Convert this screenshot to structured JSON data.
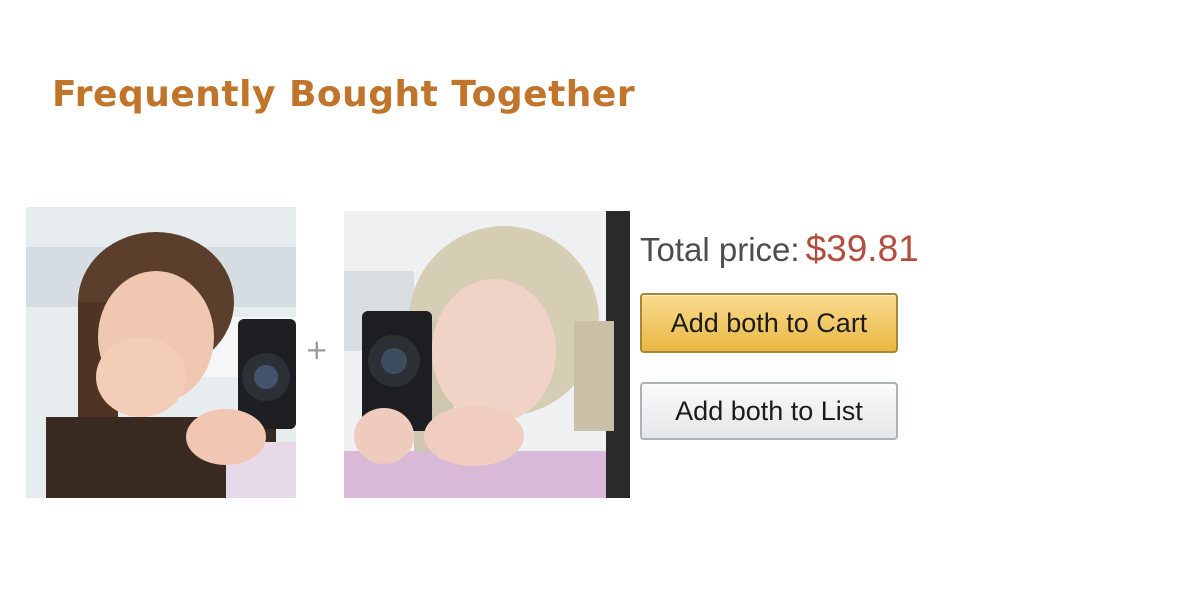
{
  "section": {
    "title": "Frequently Bought Together"
  },
  "bundle": {
    "separator": "+",
    "items": [
      {
        "image_icon": "product-photo-1"
      },
      {
        "image_icon": "product-photo-2"
      }
    ]
  },
  "summary": {
    "total_label": "Total price:",
    "total_value": "$39.81"
  },
  "actions": {
    "add_to_cart_label": "Add both to Cart",
    "add_to_list_label": "Add both to List"
  },
  "colors": {
    "title": "#c0752a",
    "price": "#b44d3e",
    "cart_button": "#f0c14b",
    "list_button": "#e7e9ec"
  }
}
